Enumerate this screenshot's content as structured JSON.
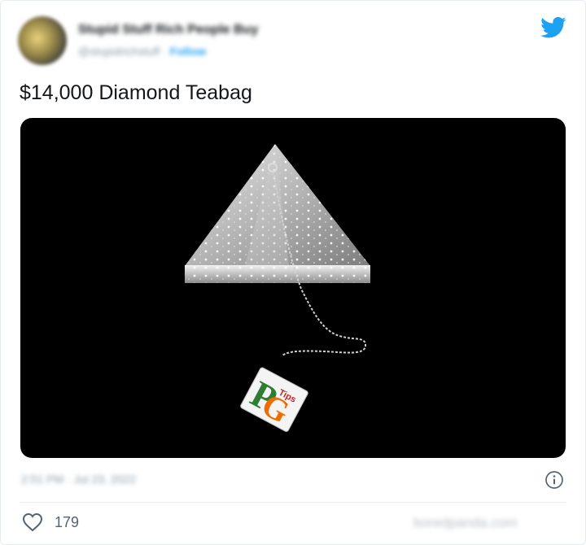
{
  "header": {
    "display_name": "Stupid Stuff Rich People Buy",
    "handle": "@stupidrichstuff",
    "separator": "·",
    "follow_label": "Follow"
  },
  "tweet": {
    "text": "$14,000 Diamond Teabag"
  },
  "media": {
    "tag_text": "Tips"
  },
  "meta": {
    "timestamp": "2:51 PM · Jul 23, 2022"
  },
  "actions": {
    "like_count": "179"
  },
  "watermark": "boredpanda.com",
  "colors": {
    "accent": "#1da1f2",
    "text": "#14171a",
    "muted": "#8899a6",
    "media_bg": "#000000"
  },
  "icons": [
    "avatar",
    "twitter-bird-icon",
    "info-icon",
    "heart-icon"
  ]
}
